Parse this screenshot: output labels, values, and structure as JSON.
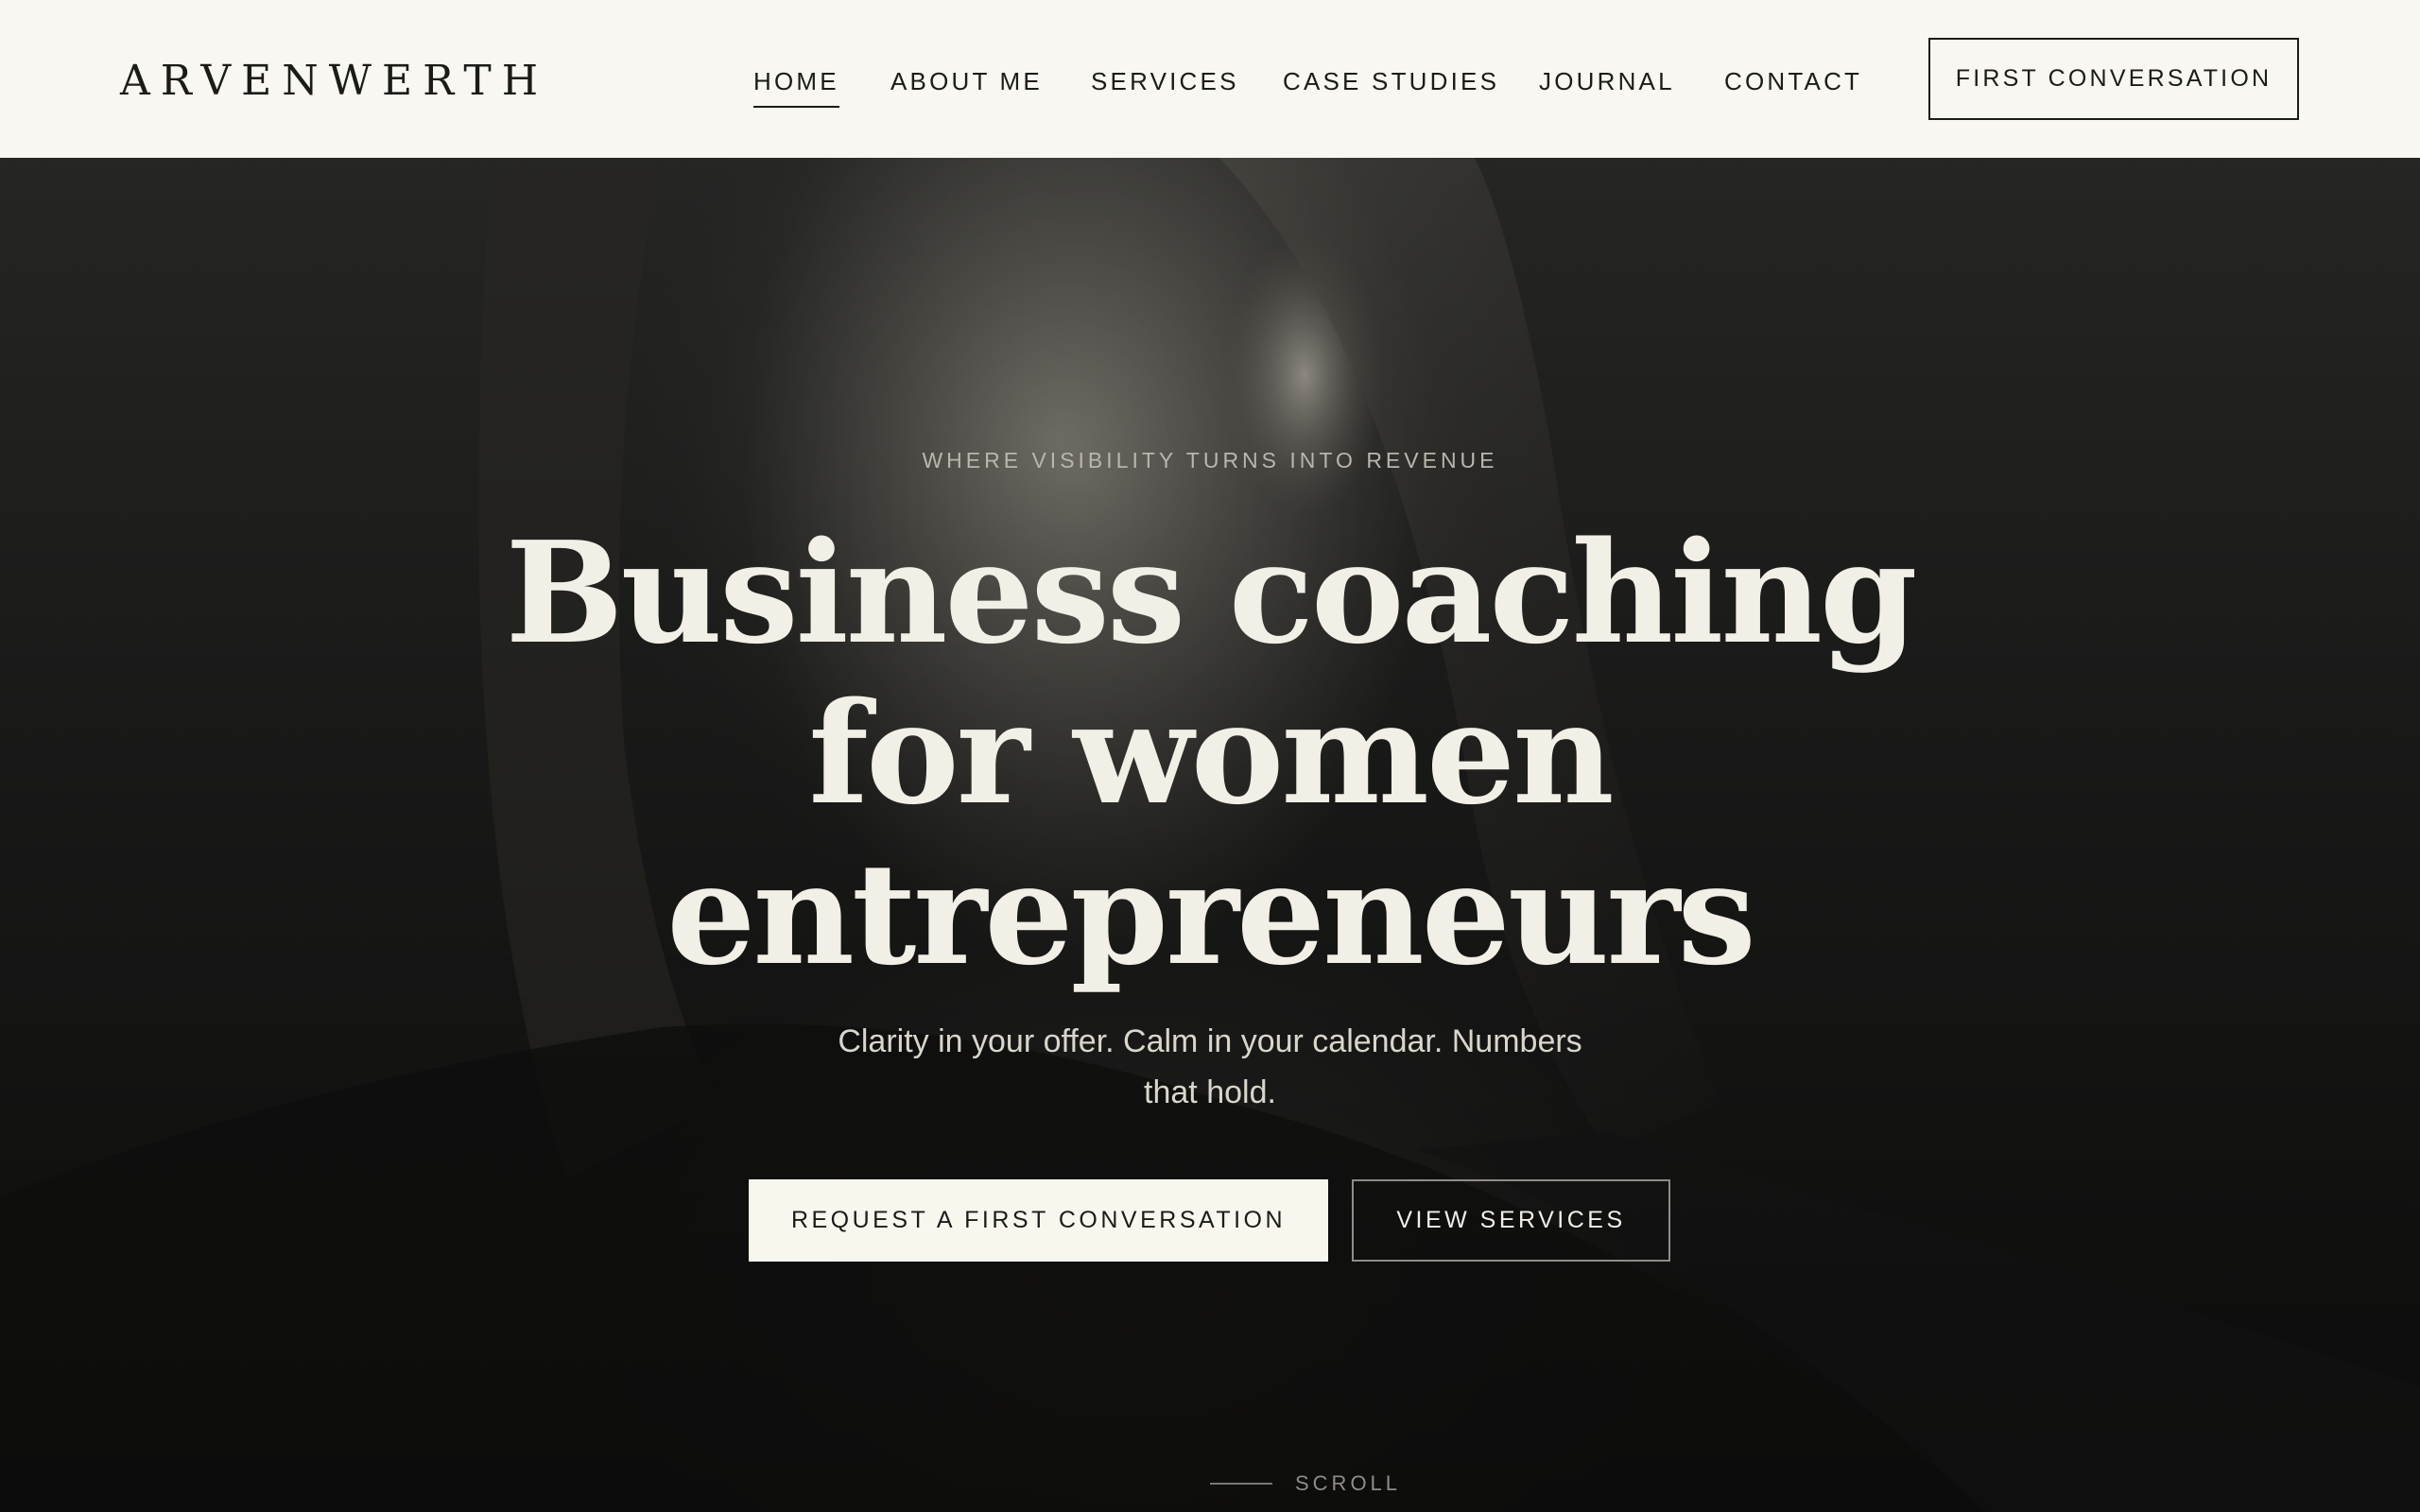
{
  "brand": {
    "logo_text": "ARVENWERTH"
  },
  "nav": {
    "items": [
      {
        "label": "HOME",
        "active": true
      },
      {
        "label": "ABOUT ME",
        "active": false
      },
      {
        "label": "SERVICES",
        "active": false
      },
      {
        "label": "CASE STUDIES",
        "active": false
      },
      {
        "label": "JOURNAL",
        "active": false
      },
      {
        "label": "CONTACT",
        "active": false
      }
    ],
    "cta_label": "FIRST CONVERSATION"
  },
  "hero": {
    "eyebrow": "WHERE VISIBILITY TURNS INTO REVENUE",
    "headline_lines": [
      "Business coaching",
      "for women",
      "entrepreneurs"
    ],
    "subline_lines": [
      "Clarity in your offer. Calm in your calendar. Numbers",
      "that hold."
    ],
    "primary_button": "REQUEST A FIRST CONVERSATION",
    "secondary_button": "VIEW SERVICES",
    "scroll_label": "SCROLL",
    "background_image": "woman-portrait-photo"
  },
  "colors": {
    "header_bg": "#f8f7f1",
    "ink": "#1b1b19",
    "hero_bg": "#1d1d1c",
    "hero_text": "#f1efe6",
    "primary_button_bg": "#f8f7ee"
  }
}
